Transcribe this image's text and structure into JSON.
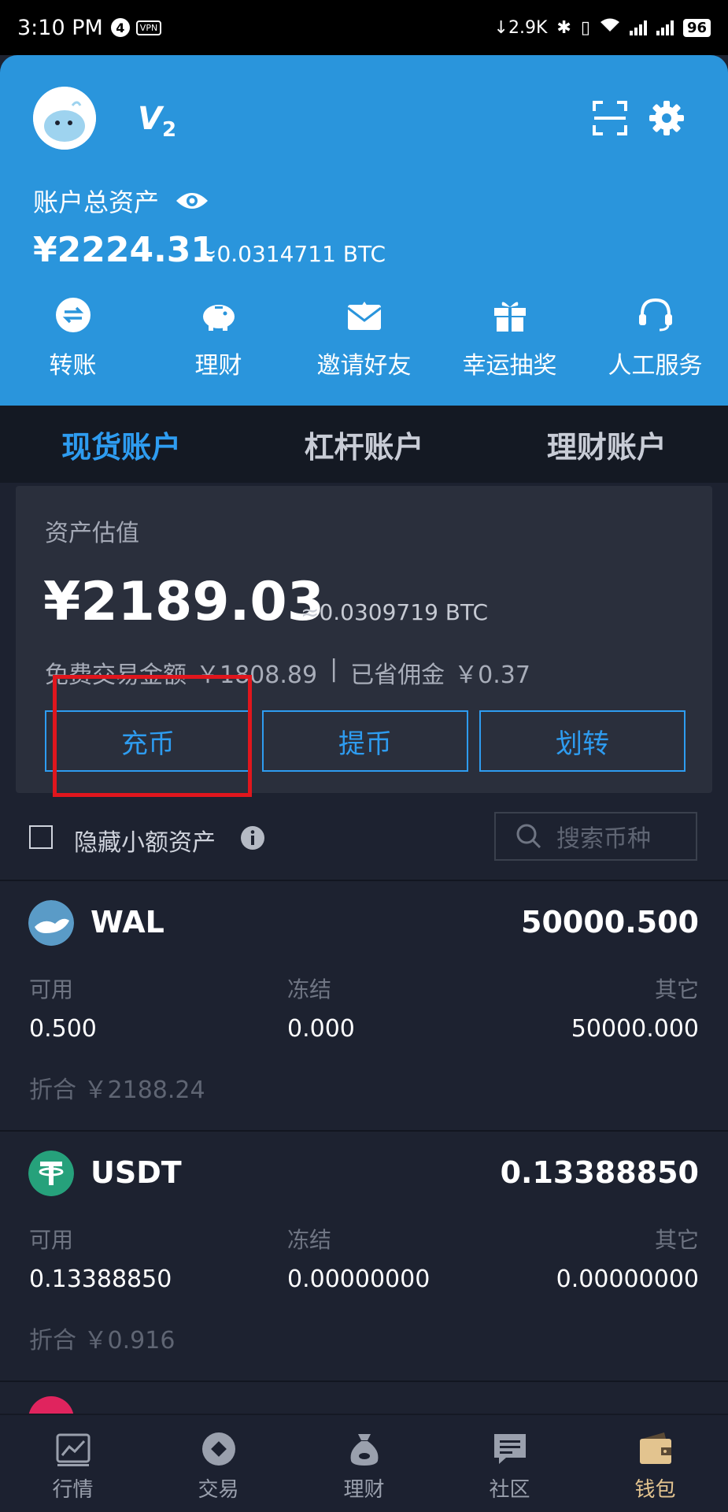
{
  "status_bar": {
    "time": "3:10 PM",
    "notification_count": "4",
    "vpn": "VPN",
    "net_speed": "↓2.9K",
    "battery": "96"
  },
  "header": {
    "level_badge": "V",
    "level_number": "2",
    "total_assets_label": "账户总资产",
    "total_amount": "¥2224.31",
    "total_btc": "≈0.0314711 BTC",
    "quick_actions": [
      {
        "label": "转账",
        "icon": "transfer-icon"
      },
      {
        "label": "理财",
        "icon": "piggy-bank-icon"
      },
      {
        "label": "邀请好友",
        "icon": "invite-envelope-icon"
      },
      {
        "label": "幸运抽奖",
        "icon": "gift-icon"
      },
      {
        "label": "人工服务",
        "icon": "headset-icon"
      }
    ]
  },
  "account_tabs": [
    {
      "label": "现货账户",
      "active": true
    },
    {
      "label": "杠杆账户",
      "active": false
    },
    {
      "label": "理财账户",
      "active": false
    }
  ],
  "asset_card": {
    "label": "资产估值",
    "amount": "¥2189.03",
    "btc": "≈0.0309719 BTC",
    "free_trade_label": "免费交易金额",
    "free_trade_value": "￥1808.89",
    "separator": "|",
    "saved_label": "已省佣金",
    "saved_value": "￥0.37",
    "buttons": {
      "deposit": "充币",
      "withdraw": "提币",
      "transfer": "划转"
    },
    "accent_color": "#2e9cf0"
  },
  "filter": {
    "hide_small_label": "隐藏小额资产",
    "hide_small_checked": false,
    "search_placeholder": "搜索币种"
  },
  "assets": [
    {
      "symbol": "WAL",
      "total": "50000.500",
      "available_label": "可用",
      "available": "0.500",
      "frozen_label": "冻结",
      "frozen": "0.000",
      "other_label": "其它",
      "other": "50000.000",
      "equiv": "折合 ￥2188.24"
    },
    {
      "symbol": "USDT",
      "total": "0.13388850",
      "available_label": "可用",
      "available": "0.13388850",
      "frozen_label": "冻结",
      "frozen": "0.00000000",
      "other_label": "其它",
      "other": "0.00000000",
      "equiv": "折合 ￥0.916"
    }
  ],
  "bottom_nav": [
    {
      "label": "行情",
      "icon": "chart-icon",
      "active": false
    },
    {
      "label": "交易",
      "icon": "trade-icon",
      "active": false
    },
    {
      "label": "理财",
      "icon": "money-bag-icon",
      "active": false
    },
    {
      "label": "社区",
      "icon": "chat-icon",
      "active": false
    },
    {
      "label": "钱包",
      "icon": "wallet-icon",
      "active": true
    }
  ]
}
